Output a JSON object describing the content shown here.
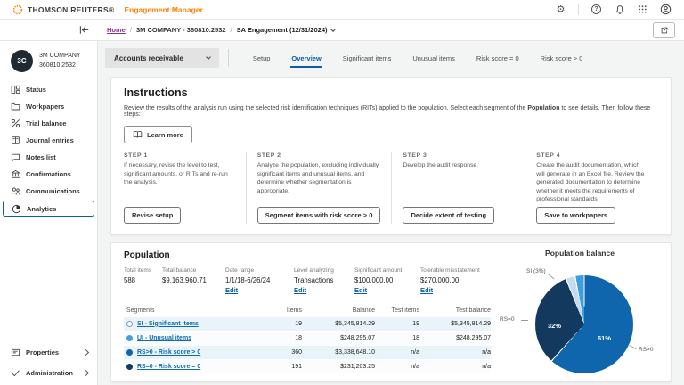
{
  "colors": {
    "brand_orange": "#ff8000",
    "link_blue": "#0b63a5",
    "active_tab_blue": "#0a5ea8",
    "home_link_purple": "#8f2d8f",
    "row_highlight": "#e9f3fa"
  },
  "header": {
    "brand": "THOMSON REUTERS®",
    "app_name": "Engagement Manager",
    "gear_glyph": "⚙",
    "help_glyph": "?"
  },
  "breadcrumb": {
    "separator": "/",
    "home": "Home",
    "client": "3M COMPANY - 360810.2532",
    "engagement": "SA Engagement (12/31/2024)"
  },
  "sidebar": {
    "avatar_initials": "3C",
    "company_name": "3M COMPANY",
    "company_number": "360810.2532",
    "items": [
      {
        "label": "Status"
      },
      {
        "label": "Workpapers"
      },
      {
        "label": "Trial balance"
      },
      {
        "label": "Journal entries"
      },
      {
        "label": "Notes list"
      },
      {
        "label": "Confirmations"
      },
      {
        "label": "Communications"
      },
      {
        "label": "Analytics",
        "active": true
      }
    ],
    "footer_items": [
      {
        "label": "Properties"
      },
      {
        "label": "Administration"
      }
    ]
  },
  "toolbar": {
    "area_dropdown": "Accounts receivable",
    "tabs": [
      {
        "label": "Setup"
      },
      {
        "label": "Overview",
        "active": true
      },
      {
        "label": "Significant items"
      },
      {
        "label": "Unusual items"
      },
      {
        "label": "Risk score = 0"
      },
      {
        "label": "Risk score > 0"
      }
    ]
  },
  "instructions": {
    "title": "Instructions",
    "body_1": "Review the results of the analysis run using the selected risk identification techniques (RITs) applied to the population. Select each segment of the ",
    "body_bold": "Population",
    "body_2": " to see details. Then follow these steps:",
    "learn_more_label": "Learn more",
    "steps": [
      {
        "title": "STEP 1",
        "text": "If necessary, revise the level to test, significant amounts, or RITs and re-run the analysis.",
        "button": "Revise setup"
      },
      {
        "title": "STEP 2",
        "text": "Analyze the population, excluding individually significant items and unusual items, and determine whether segmentation is appropriate.",
        "button": "Segment items with risk score > 0"
      },
      {
        "title": "STEP 3",
        "text": "Develop the audit response.",
        "button": "Decide extent of testing"
      },
      {
        "title": "STEP 4",
        "text": "Create the audit documentation, which will generate in an Excel file. Review the generated documentation to determine whether it meets the requirements of professional standards.",
        "button": "Save to workpapers"
      }
    ]
  },
  "population": {
    "title": "Population",
    "stats": [
      {
        "label": "Total items",
        "value": "588"
      },
      {
        "label": "Total balance",
        "value": "$9,163,960.71"
      },
      {
        "label": "Date range",
        "value": "1/1/18-6/26/24",
        "edit": "Edit"
      },
      {
        "label": "Level analyzing",
        "value": "Transactions",
        "edit": "Edit"
      },
      {
        "label": "Significant amount",
        "value": "$100,000.00",
        "edit": "Edit"
      },
      {
        "label": "Tolerable misstatement",
        "value": "$270,000.00",
        "edit": "Edit"
      }
    ],
    "table": {
      "headers": [
        "Segments",
        "Items",
        "Balance",
        "Test items",
        "Test balance"
      ],
      "rows": [
        {
          "dot_color": "#ffffff",
          "name": "SI - Significant items",
          "items": "19",
          "balance": "$5,345,814.29",
          "test_items": "19",
          "test_balance": "$5,345,814.29"
        },
        {
          "dot_color": "#41a0e1",
          "name": "UI - Unusual items",
          "items": "18",
          "balance": "$248,295.07",
          "test_items": "18",
          "test_balance": "$248,295.07"
        },
        {
          "dot_color": "#1066ac",
          "name": "RS>0 - Risk score > 0",
          "items": "360",
          "balance": "$3,338,648.10",
          "test_items": "n/a",
          "test_balance": "n/a"
        },
        {
          "dot_color": "#14395e",
          "name": "RS=0 - Risk score = 0",
          "items": "191",
          "balance": "$231,203.25",
          "test_items": "n/a",
          "test_balance": "n/a"
        }
      ]
    }
  },
  "chart_data": {
    "type": "pie",
    "title": "Population balance",
    "series": [
      {
        "name": "RS>0 - Risk score > 0",
        "pct": 61,
        "color": "#1066ac",
        "inside_label": "61%",
        "outside_label": "RS>0"
      },
      {
        "name": "RS=0 - Risk score = 0",
        "pct": 32,
        "color": "#14395e",
        "inside_label": "32%",
        "outside_label": "RS=0"
      },
      {
        "name": "SI - Significant items",
        "pct": 3,
        "color": "#c3dcf1",
        "outside_label": "SI (3%)"
      },
      {
        "name": "UI - Unusual items",
        "pct": 3,
        "color": "#3c9de0",
        "outside_label": ""
      }
    ],
    "legend_position": "none"
  }
}
